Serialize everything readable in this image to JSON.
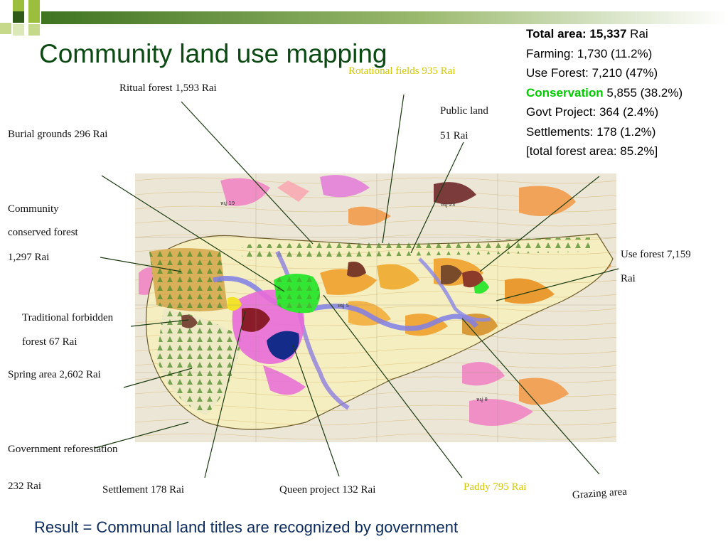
{
  "title": "Community land use mapping",
  "stats": {
    "total_label": "Total area: 15,337",
    "total_unit": " Rai",
    "farming": "Farming: 1,730 (11.2%)",
    "use_forest": "Use Forest: 7,210 (47%)",
    "conservation_label": "Conservation",
    "conservation_value": " 5,855 (38.2%)",
    "govt_project": "Govt Project: 364 (2.4%)",
    "settlements": "Settlements: 178 (1.2%)",
    "total_forest": "[total forest area: 85.2%]"
  },
  "labels": {
    "rotational_fields": "Rotational fields 935 Rai",
    "ritual_forest": "Ritual forest 1,593 Rai",
    "public_land_1": "Public land",
    "public_land_2": "51 Rai",
    "burial_grounds": "Burial grounds 296 Rai",
    "community_1": "Community",
    "community_2": "conserved forest",
    "community_3": "1,297 Rai",
    "use_forest_1": "Use forest 7,159",
    "use_forest_2": "Rai",
    "traditional_1": "Traditional forbidden",
    "traditional_2": "forest 67 Rai",
    "spring": "Spring area 2,602 Rai",
    "gov_reforest_1": "Government reforestation",
    "gov_reforest_2": "232 Rai",
    "settlement": "Settlement 178 Rai",
    "queen_project": "Queen project 132 Rai",
    "paddy": "Paddy 795 Rai",
    "grazing": "Grazing area"
  },
  "map_labels": {
    "m1": "หมู่ 19",
    "m2": "หมู่ 23",
    "m3": "หมู่ 8",
    "m4": "หมู่ 5"
  },
  "result": "Result = Communal land titles are recognized by government",
  "colors": {
    "title": "#0b4a12",
    "conservation": "#00cc00",
    "deco_green": "#8db33a",
    "deco_dark": "#3a6b1e",
    "result": "#0a2a5e"
  }
}
